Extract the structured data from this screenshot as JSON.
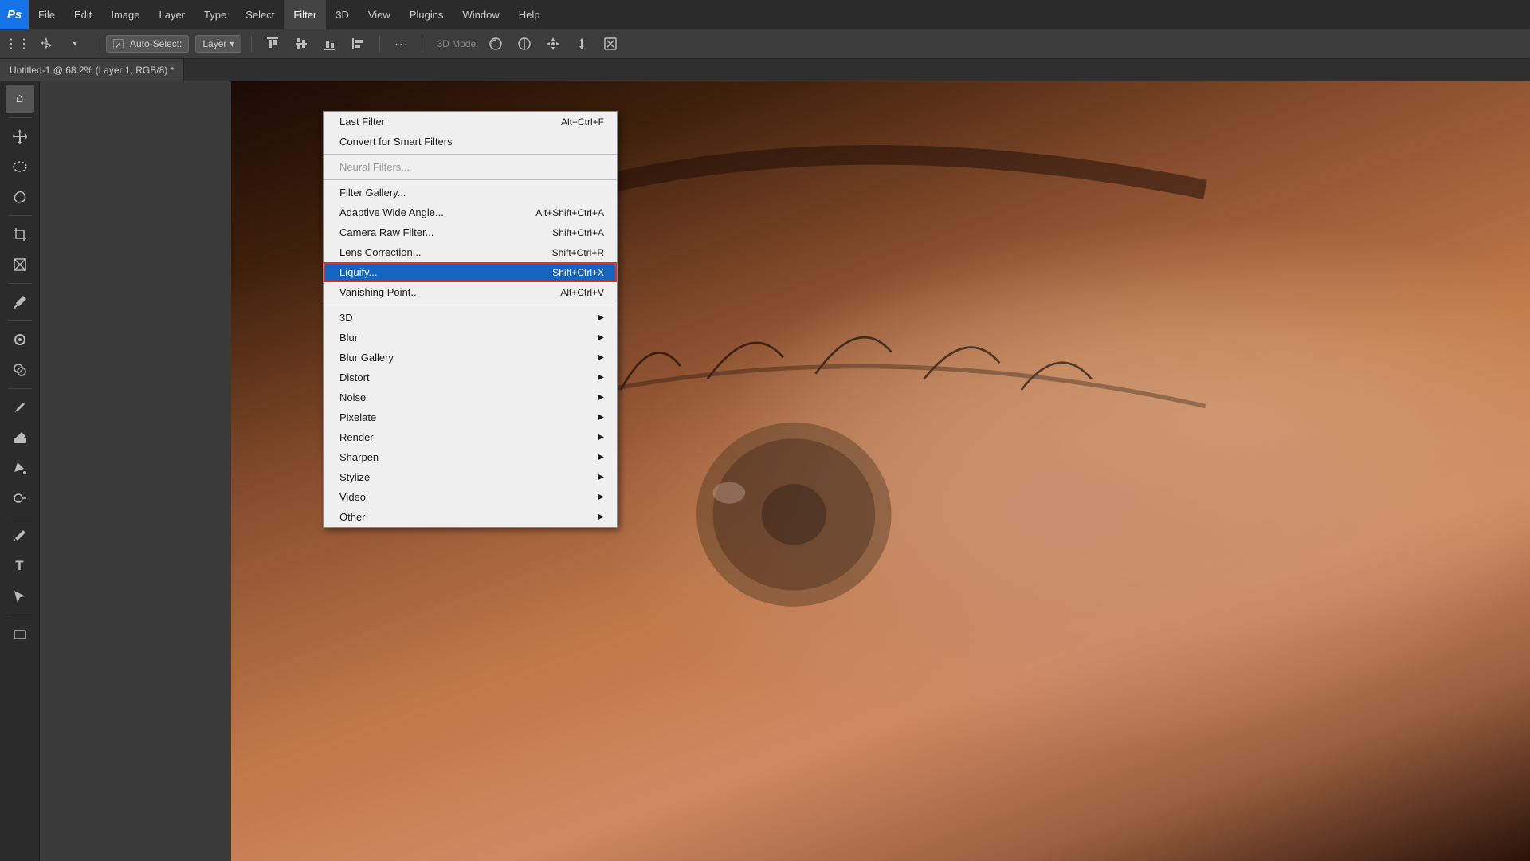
{
  "app": {
    "logo": "Ps",
    "logo_bg": "#1473e6"
  },
  "menu_bar": {
    "items": [
      {
        "label": "File",
        "active": false
      },
      {
        "label": "Edit",
        "active": false
      },
      {
        "label": "Image",
        "active": false
      },
      {
        "label": "Layer",
        "active": false
      },
      {
        "label": "Type",
        "active": false
      },
      {
        "label": "Select",
        "active": false
      },
      {
        "label": "Filter",
        "active": true
      },
      {
        "label": "3D",
        "active": false
      },
      {
        "label": "View",
        "active": false
      },
      {
        "label": "Plugins",
        "active": false
      },
      {
        "label": "Window",
        "active": false
      },
      {
        "label": "Help",
        "active": false
      }
    ]
  },
  "options_bar": {
    "tool_label": "Auto-Select:",
    "tool_value": "Layer",
    "dropdown_arrow": "▾",
    "extras_label": "..."
  },
  "tab_bar": {
    "doc_title": "Untitled-1 @ 68.2% (Layer 1, RGB/8) *"
  },
  "filter_menu": {
    "title": "Filter",
    "items": [
      {
        "label": "Last Filter",
        "shortcut": "Alt+Ctrl+F",
        "disabled": false,
        "has_submenu": false,
        "highlighted": false,
        "separator_after": false
      },
      {
        "label": "Convert for Smart Filters",
        "shortcut": "",
        "disabled": false,
        "has_submenu": false,
        "highlighted": false,
        "separator_after": false
      },
      {
        "separator": true
      },
      {
        "label": "Neural Filters...",
        "shortcut": "",
        "disabled": true,
        "has_submenu": false,
        "highlighted": false,
        "separator_after": false
      },
      {
        "separator": true
      },
      {
        "label": "Filter Gallery...",
        "shortcut": "",
        "disabled": false,
        "has_submenu": false,
        "highlighted": false,
        "separator_after": false
      },
      {
        "label": "Adaptive Wide Angle...",
        "shortcut": "Alt+Shift+Ctrl+A",
        "disabled": false,
        "has_submenu": false,
        "highlighted": false,
        "separator_after": false
      },
      {
        "label": "Camera Raw Filter...",
        "shortcut": "Shift+Ctrl+A",
        "disabled": false,
        "has_submenu": false,
        "highlighted": false,
        "separator_after": false
      },
      {
        "label": "Lens Correction...",
        "shortcut": "Shift+Ctrl+R",
        "disabled": false,
        "has_submenu": false,
        "highlighted": false,
        "separator_after": false
      },
      {
        "label": "Liquify...",
        "shortcut": "Shift+Ctrl+X",
        "disabled": false,
        "has_submenu": false,
        "highlighted": true,
        "separator_after": false
      },
      {
        "label": "Vanishing Point...",
        "shortcut": "Alt+Ctrl+V",
        "disabled": false,
        "has_submenu": false,
        "highlighted": false,
        "separator_after": true
      },
      {
        "label": "3D",
        "shortcut": "",
        "disabled": false,
        "has_submenu": true,
        "highlighted": false,
        "separator_after": false
      },
      {
        "label": "Blur",
        "shortcut": "",
        "disabled": false,
        "has_submenu": true,
        "highlighted": false,
        "separator_after": false
      },
      {
        "label": "Blur Gallery",
        "shortcut": "",
        "disabled": false,
        "has_submenu": true,
        "highlighted": false,
        "separator_after": false
      },
      {
        "label": "Distort",
        "shortcut": "",
        "disabled": false,
        "has_submenu": true,
        "highlighted": false,
        "separator_after": false
      },
      {
        "label": "Noise",
        "shortcut": "",
        "disabled": false,
        "has_submenu": true,
        "highlighted": false,
        "separator_after": false
      },
      {
        "label": "Pixelate",
        "shortcut": "",
        "disabled": false,
        "has_submenu": true,
        "highlighted": false,
        "separator_after": false
      },
      {
        "label": "Render",
        "shortcut": "",
        "disabled": false,
        "has_submenu": true,
        "highlighted": false,
        "separator_after": false
      },
      {
        "label": "Sharpen",
        "shortcut": "",
        "disabled": false,
        "has_submenu": true,
        "highlighted": false,
        "separator_after": false
      },
      {
        "label": "Stylize",
        "shortcut": "",
        "disabled": false,
        "has_submenu": true,
        "highlighted": false,
        "separator_after": false
      },
      {
        "label": "Video",
        "shortcut": "",
        "disabled": false,
        "has_submenu": true,
        "highlighted": false,
        "separator_after": false
      },
      {
        "label": "Other",
        "shortcut": "",
        "disabled": false,
        "has_submenu": true,
        "highlighted": false,
        "separator_after": false
      }
    ]
  },
  "tools": [
    {
      "name": "home",
      "icon": "⌂",
      "active": true
    },
    {
      "name": "move",
      "icon": "✛",
      "active": false
    },
    {
      "name": "ellipse-select",
      "icon": "○",
      "active": false
    },
    {
      "name": "lasso",
      "icon": "⌒",
      "active": false
    },
    {
      "name": "brush",
      "icon": "⬚",
      "active": false
    },
    {
      "name": "crop",
      "icon": "⊡",
      "active": false
    },
    {
      "name": "frame",
      "icon": "⊠",
      "active": false
    },
    {
      "name": "eyedropper",
      "icon": "⁄",
      "active": false
    },
    {
      "name": "healing",
      "icon": "✚",
      "active": false
    },
    {
      "name": "clone",
      "icon": "⊕",
      "active": false
    },
    {
      "name": "eraser",
      "icon": "◻",
      "active": false
    },
    {
      "name": "paint",
      "icon": "△",
      "active": false
    },
    {
      "name": "dodge",
      "icon": "◯",
      "active": false
    },
    {
      "name": "pen",
      "icon": "⌘",
      "active": false
    },
    {
      "name": "type",
      "icon": "T",
      "active": false
    },
    {
      "name": "path-select",
      "icon": "↖",
      "active": false
    },
    {
      "name": "shape",
      "icon": "▭",
      "active": false
    }
  ]
}
